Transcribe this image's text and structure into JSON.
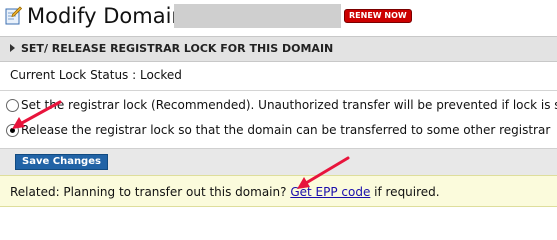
{
  "header": {
    "title": "Modify Domain:",
    "renew_badge": "RENEW NOW",
    "icon": "edit-icon"
  },
  "section": {
    "title": "SET/ RELEASE REGISTRAR LOCK FOR THIS DOMAIN",
    "icon": "triangle-right-icon"
  },
  "lock_status": {
    "text": "Current Lock Status : Locked"
  },
  "options": [
    {
      "label": "Set the registrar lock (Recommended). Unauthorized transfer will be prevented if lock is set.",
      "selected": false
    },
    {
      "label": "Release the registrar lock so that the domain can be transferred to some other registrar",
      "selected": true
    }
  ],
  "actions": {
    "save_label": "Save Changes"
  },
  "related": {
    "prefix": "Related: Planning to transfer out this domain? ",
    "link_text": "Get EPP code",
    "suffix": " if required."
  },
  "colors": {
    "section_bar": "#e3e3e3",
    "save_button": "#2163a6",
    "related_bar": "#fbfbdc",
    "renew_badge": "#cc0000",
    "annotation_arrow": "#e8143c",
    "link": "#1a0dab"
  }
}
